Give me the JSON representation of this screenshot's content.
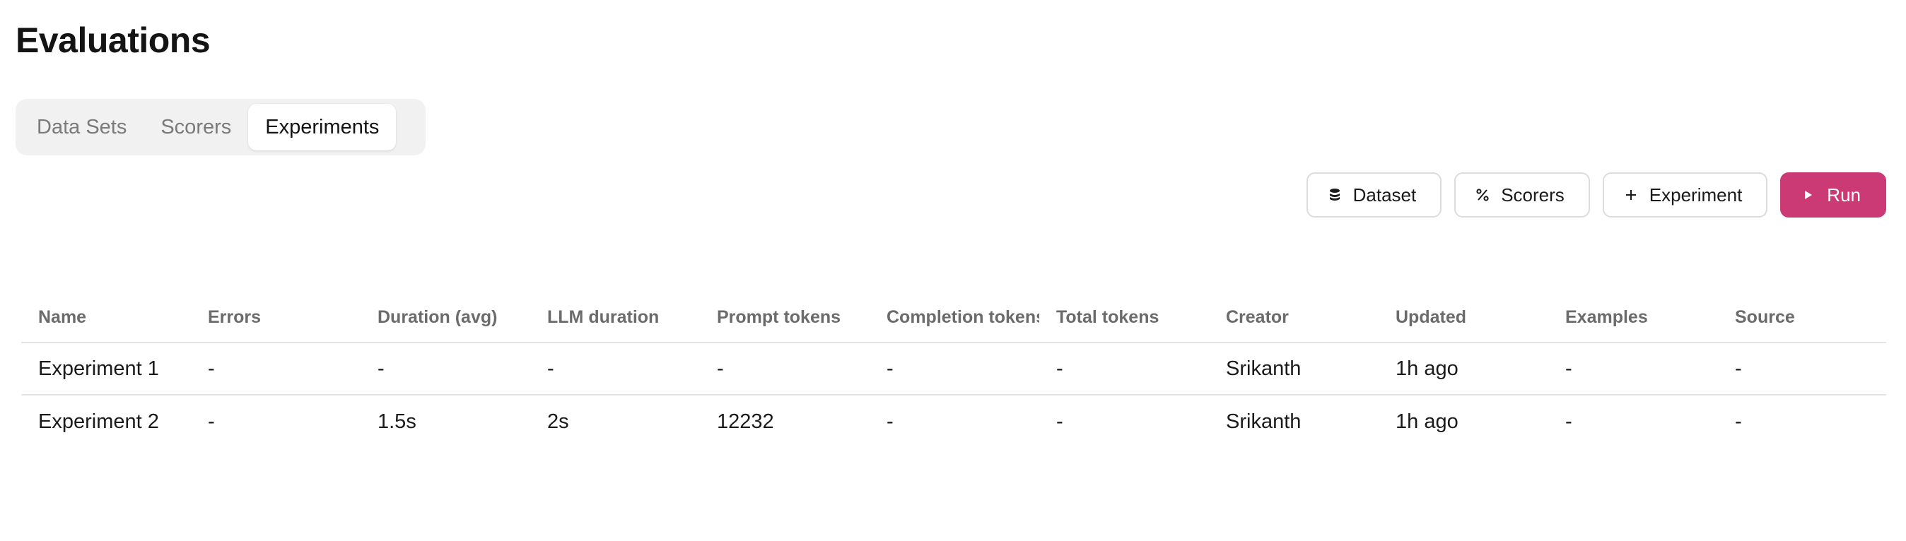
{
  "page": {
    "title": "Evaluations"
  },
  "tabs": [
    {
      "label": "Data Sets",
      "active": false
    },
    {
      "label": "Scorers",
      "active": false
    },
    {
      "label": "Experiments",
      "active": true
    }
  ],
  "toolbar": {
    "dataset_label": "Dataset",
    "dataset_icon": "database-icon",
    "scorers_label": "Scorers",
    "scorers_icon": "percent-icon",
    "experiment_label": "Experiment",
    "experiment_icon": "plus-icon",
    "run_label": "Run",
    "run_icon": "play-icon"
  },
  "colors": {
    "accent": "#cc3a75"
  },
  "table": {
    "columns": [
      "Name",
      "Errors",
      "Duration (avg)",
      "LLM duration",
      "Prompt tokens",
      "Completion tokens",
      "Total tokens",
      "Creator",
      "Updated",
      "Examples",
      "Source"
    ],
    "rows": [
      [
        "Experiment 1",
        "-",
        "-",
        "-",
        "-",
        "-",
        "-",
        "Srikanth",
        "1h ago",
        "-",
        "-"
      ],
      [
        "Experiment 2",
        "-",
        "1.5s",
        "2s",
        "12232",
        "-",
        "-",
        "Srikanth",
        "1h ago",
        "-",
        "-"
      ]
    ]
  }
}
